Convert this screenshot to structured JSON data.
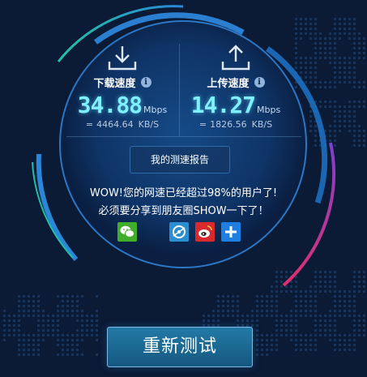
{
  "download": {
    "label": "下载速度",
    "speed": "34.88",
    "unit": "Mbps",
    "kb_prefix": "=",
    "kb_value": "4464.64",
    "kb_unit": "KB/S",
    "icon": "download-arrow-icon"
  },
  "upload": {
    "label": "上传速度",
    "speed": "14.27",
    "unit": "Mbps",
    "kb_prefix": "=",
    "kb_value": "1826.56",
    "kb_unit": "KB/S",
    "icon": "upload-arrow-icon"
  },
  "info_glyph": "i",
  "report_button": "我的测速报告",
  "message_line1": "WOW!您的网速已经超过98%的用户了!",
  "message_line2": "必须要分享到朋友圈SHOW一下了！",
  "share_icons": [
    "wechat-icon",
    "qzone-icon",
    "weibo-icon",
    "more-share-icon"
  ],
  "retest_button": "重新测试",
  "colors": {
    "background": "#0b1a35",
    "speed_digits": "#7ff0ff",
    "ring_teal": "#1fbfa8",
    "ring_blue": "#2a86d8",
    "ring_magenta": "#d6327a"
  }
}
